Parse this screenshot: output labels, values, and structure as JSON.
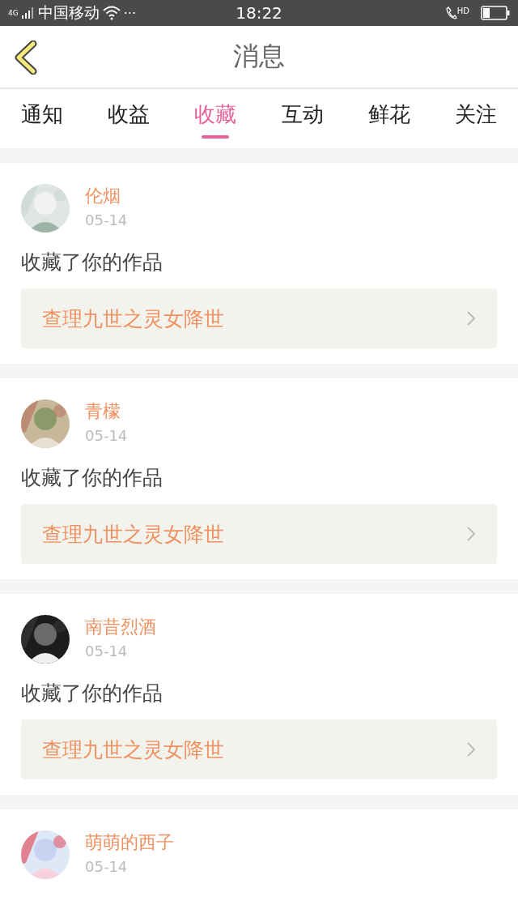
{
  "status_bar": {
    "carrier": "中国移动",
    "network": "4G",
    "more": "···",
    "time": "18:22",
    "call_badge": "HD"
  },
  "header": {
    "title": "消息"
  },
  "tabs": [
    {
      "label": "通知",
      "selected": false
    },
    {
      "label": "收益",
      "selected": false
    },
    {
      "label": "收藏",
      "selected": true
    },
    {
      "label": "互动",
      "selected": false
    },
    {
      "label": "鲜花",
      "selected": false
    },
    {
      "label": "关注",
      "selected": false
    }
  ],
  "messages": [
    {
      "user": "伦烟",
      "date": "05-14",
      "action": "收藏了你的作品",
      "work": "查理九世之灵女降世"
    },
    {
      "user": "青檬",
      "date": "05-14",
      "action": "收藏了你的作品",
      "work": "查理九世之灵女降世"
    },
    {
      "user": "南昔烈酒",
      "date": "05-14",
      "action": "收藏了你的作品",
      "work": "查理九世之灵女降世"
    },
    {
      "user": "萌萌的西子",
      "date": "05-14"
    }
  ]
}
